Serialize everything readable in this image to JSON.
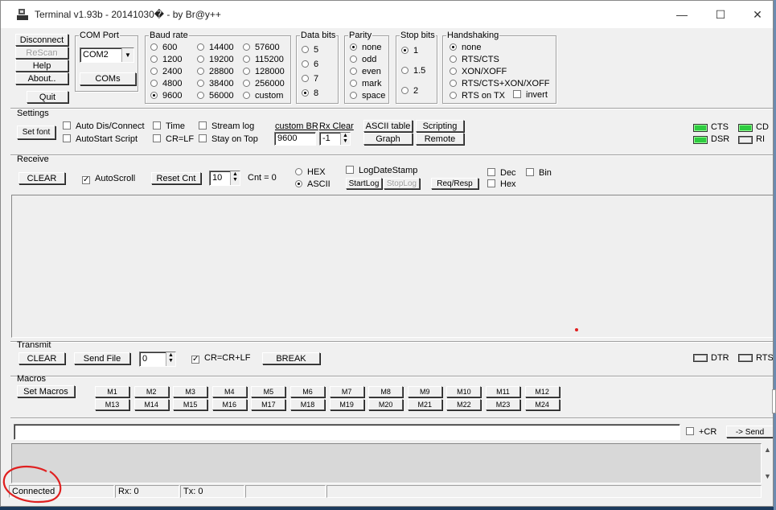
{
  "window": {
    "title": "Terminal v1.93b - 20141030� - by Br@y++",
    "min": "—",
    "max": "☐",
    "close": "✕"
  },
  "top_buttons": {
    "disconnect": "Disconnect",
    "rescan": "ReScan",
    "help": "Help",
    "about": "About..",
    "quit": "Quit"
  },
  "com_port": {
    "label": "COM Port",
    "value": "COM2",
    "coms_button": "COMs"
  },
  "baud": {
    "label": "Baud rate",
    "options": [
      "600",
      "1200",
      "2400",
      "4800",
      "9600",
      "14400",
      "19200",
      "28800",
      "38400",
      "56000",
      "57600",
      "115200",
      "128000",
      "256000",
      "custom"
    ],
    "selected": "9600"
  },
  "data_bits": {
    "label": "Data bits",
    "options": [
      "5",
      "6",
      "7",
      "8"
    ],
    "selected": "8"
  },
  "parity": {
    "label": "Parity",
    "options": [
      "none",
      "odd",
      "even",
      "mark",
      "space"
    ],
    "selected": "none"
  },
  "stop_bits": {
    "label": "Stop bits",
    "options": [
      "1",
      "1.5",
      "2"
    ],
    "selected": "1"
  },
  "handshaking": {
    "label": "Handshaking",
    "options": [
      "none",
      "RTS/CTS",
      "XON/XOFF",
      "RTS/CTS+XON/XOFF",
      "RTS on TX"
    ],
    "selected": "none",
    "invert": "invert"
  },
  "settings": {
    "label": "Settings",
    "set_font": "Set font",
    "auto_dis_connect": "Auto Dis/Connect",
    "autostart_script": "AutoStart Script",
    "time": "Time",
    "cr_lf": "CR=LF",
    "stream_log": "Stream log",
    "stay_on_top": "Stay on Top",
    "custom_br_label": "custom BR",
    "custom_br_value": "9600",
    "rx_clear_label": "Rx Clear",
    "rx_clear_value": "-1",
    "ascii_table": "ASCII table",
    "scripting": "Scripting",
    "graph": "Graph",
    "remote": "Remote"
  },
  "signals": {
    "cts": "CTS",
    "cd": "CD",
    "dsr": "DSR",
    "ri": "RI",
    "dtr": "DTR",
    "rts": "RTS"
  },
  "receive": {
    "label": "Receive",
    "clear": "CLEAR",
    "autoscroll": "AutoScroll",
    "reset_cnt": "Reset Cnt",
    "cnt_spin_value": "10",
    "cnt_label": "Cnt = ",
    "cnt_value": "0",
    "hex": "HEX",
    "ascii": "ASCII",
    "selected_mode": "ASCII",
    "logdatestamp": "LogDateStamp",
    "startlog": "StartLog",
    "stoplog": "StopLog",
    "req_resp": "Req/Resp",
    "dec": "Dec",
    "hexchk": "Hex",
    "bin": "Bin"
  },
  "transmit": {
    "label": "Transmit",
    "clear": "CLEAR",
    "send_file": "Send File",
    "spin_value": "0",
    "cr_crlf": "CR=CR+LF",
    "break": "BREAK"
  },
  "macros": {
    "label": "Macros",
    "set_macros": "Set Macros",
    "row1": [
      "M1",
      "M2",
      "M3",
      "M4",
      "M5",
      "M6",
      "M7",
      "M8",
      "M9",
      "M10",
      "M11",
      "M12"
    ],
    "row2": [
      "M13",
      "M14",
      "M15",
      "M16",
      "M17",
      "M18",
      "M19",
      "M20",
      "M21",
      "M22",
      "M23",
      "M24"
    ]
  },
  "send": {
    "input_value": "",
    "plus_cr": "+CR",
    "send_button": "-> Send"
  },
  "status": {
    "connection": "Connected",
    "rx": "Rx: 0",
    "tx": "Tx: 0"
  },
  "colors": {
    "led_on": "#2ecc40",
    "annotation": "#e02020",
    "desktop": "#1b3a5c"
  }
}
